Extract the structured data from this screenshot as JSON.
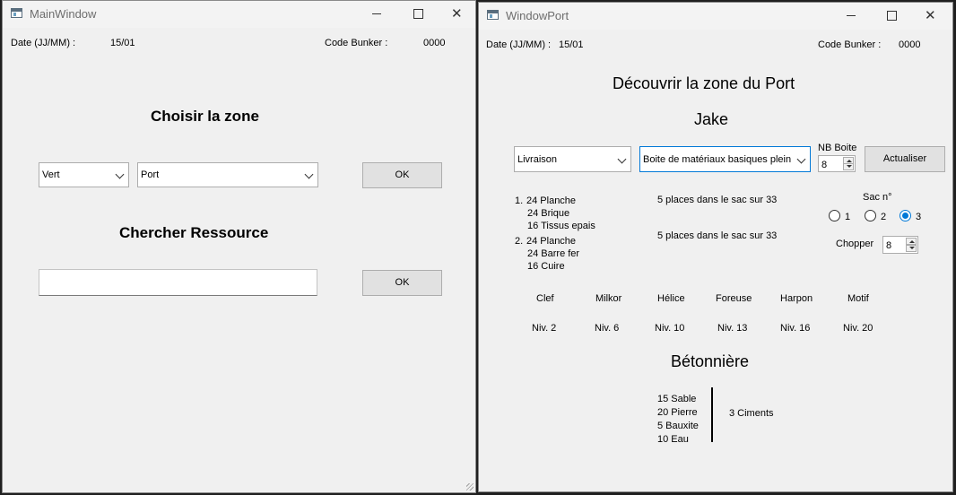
{
  "main_window": {
    "title": "MainWindow",
    "date_label": "Date (JJ/MM) :",
    "date_value": "15/01",
    "code_label": "Code Bunker :",
    "code_value": "0000",
    "zone_heading": "Choisir la zone",
    "color_select": "Vert",
    "zone_select": "Port",
    "zone_ok": "OK",
    "search_heading": "Chercher Ressource",
    "search_value": "",
    "search_ok": "OK"
  },
  "port_window": {
    "title": "WindowPort",
    "date_label": "Date (JJ/MM) :",
    "date_value": "15/01",
    "code_label": "Code Bunker :",
    "code_value": "0000",
    "heading": "Découvrir la zone du Port",
    "npc_name": "Jake",
    "mode_select": "Livraison",
    "box_select": "Boite de matériaux basiques plein",
    "nb_boite_label": "NB Boite",
    "nb_boite_value": "8",
    "refresh_button": "Actualiser",
    "orders": [
      {
        "num": "1.",
        "lines": [
          "24 Planche",
          "24 Brique",
          "16 Tissus epais"
        ],
        "status": "5 places dans le sac sur 33"
      },
      {
        "num": "2.",
        "lines": [
          "24 Planche",
          "24 Barre fer",
          "16 Cuire"
        ],
        "status": "5 places dans le sac sur 33"
      }
    ],
    "sac_label": "Sac n°",
    "sac_options": [
      "1",
      "2",
      "3"
    ],
    "sac_selected": "3",
    "chopper_label": "Chopper",
    "chopper_value": "8",
    "tools": [
      {
        "name": "Clef",
        "level": "Niv. 2"
      },
      {
        "name": "Milkor",
        "level": "Niv. 6"
      },
      {
        "name": "Hélice",
        "level": "Niv. 10"
      },
      {
        "name": "Foreuse",
        "level": "Niv. 13"
      },
      {
        "name": "Harpon",
        "level": "Niv. 16"
      },
      {
        "name": "Motif",
        "level": "Niv. 20"
      }
    ],
    "mixer_heading": "Bétonnière",
    "mixer_inputs": [
      "15 Sable",
      "20 Pierre",
      "5 Bauxite",
      "10 Eau"
    ],
    "mixer_output": "3 Ciments"
  }
}
